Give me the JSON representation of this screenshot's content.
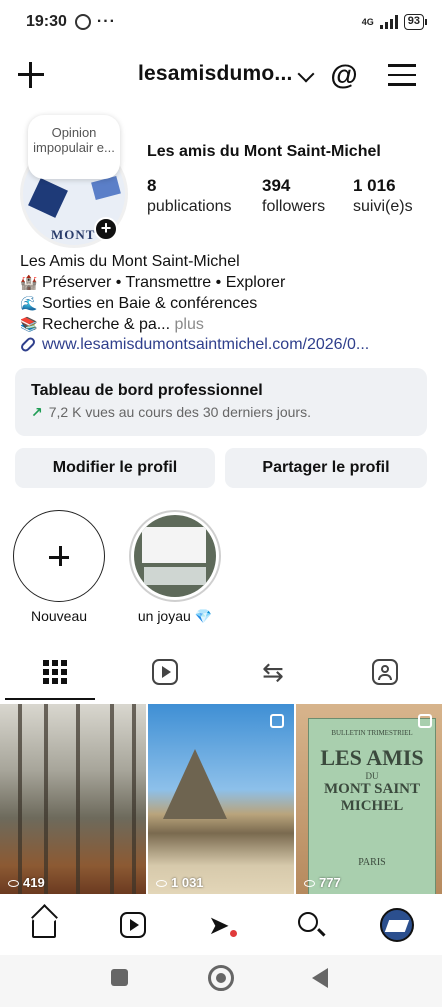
{
  "status_bar": {
    "time": "19:30",
    "dots": "···",
    "network": "4G",
    "battery": "93"
  },
  "header": {
    "username": "lesamisdumo...",
    "threads_glyph": "@"
  },
  "profile": {
    "note": "Opinion impopulair e...",
    "avatar_text": "MONT",
    "name": "Les amis du Mont Saint-Michel",
    "stats": [
      {
        "value": "8",
        "label": "publications"
      },
      {
        "value": "394",
        "label": "followers"
      },
      {
        "value": "1 016",
        "label": "suivi(e)s"
      }
    ]
  },
  "bio": {
    "title": "Les Amis du Mont Saint-Michel",
    "lines": [
      {
        "emoji": "🏰",
        "text": "Préserver • Transmettre • Explorer"
      },
      {
        "emoji": "🌊",
        "text": "Sorties en Baie & conférences"
      },
      {
        "emoji": "📚",
        "text": "Recherche & pa..."
      }
    ],
    "more": " plus",
    "link": "www.lesamisdumontsaintmichel.com/2026/0..."
  },
  "dashboard": {
    "title": "Tableau de bord professionnel",
    "trend_arrow": "↗",
    "subtitle": "7,2 K vues au cours des 30 derniers jours.",
    "accent": "#1f9d55"
  },
  "buttons": {
    "edit": "Modifier le profil",
    "share": "Partager le profil"
  },
  "highlights": [
    {
      "label": "Nouveau"
    },
    {
      "label": "un joyau 💎"
    }
  ],
  "tabs": [
    "grid",
    "reels",
    "reposts",
    "tagged"
  ],
  "posts": [
    {
      "views": "419",
      "multi": false
    },
    {
      "views": "1 031",
      "multi": true
    },
    {
      "views": "777",
      "multi": true,
      "book_lines": [
        "BULLETIN TRIMESTRIEL",
        "LES AMIS",
        "DU",
        "MONT SAINT MICHEL",
        "PARIS"
      ]
    }
  ],
  "bottom_nav": [
    "home",
    "reels",
    "messages",
    "search",
    "profile"
  ]
}
